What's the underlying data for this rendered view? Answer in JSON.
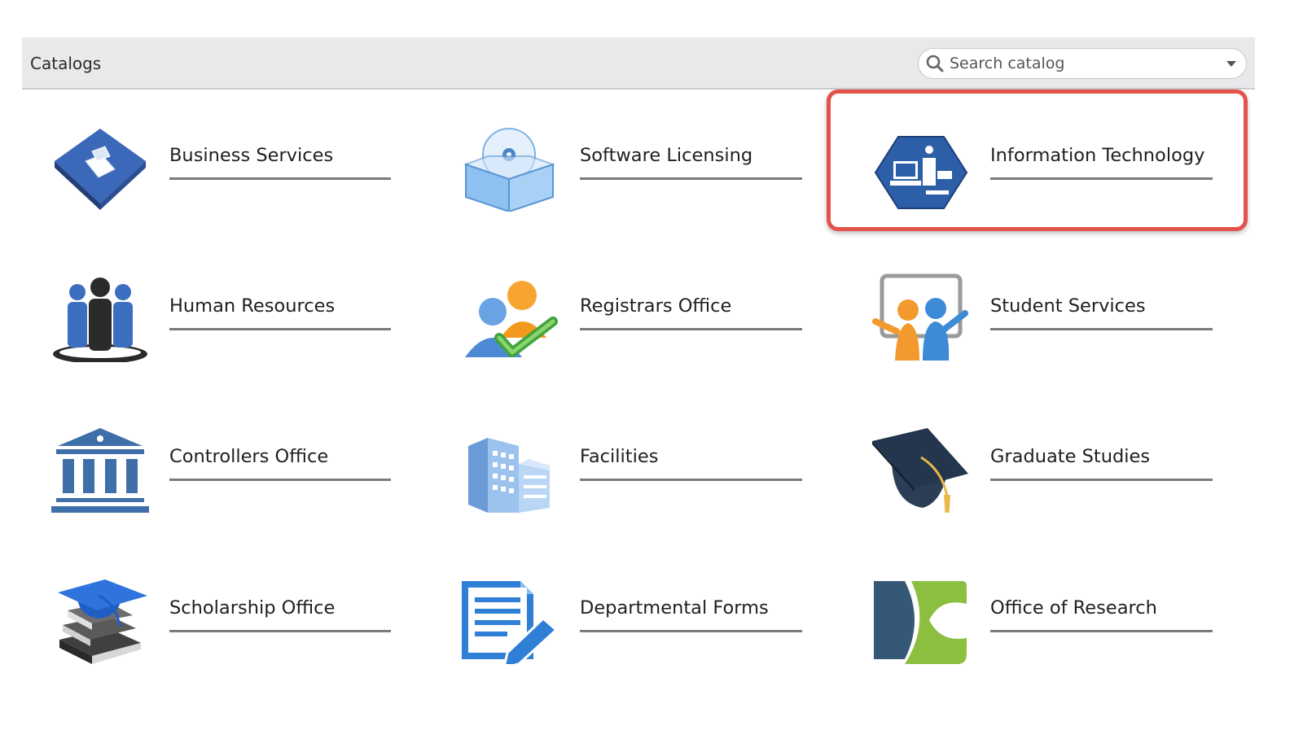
{
  "header": {
    "title": "Catalogs",
    "search_placeholder": "Search catalog"
  },
  "catalogs": [
    {
      "label": "Business Services",
      "icon": "folder-icon"
    },
    {
      "label": "Software Licensing",
      "icon": "software-box-icon"
    },
    {
      "label": "Information Technology",
      "icon": "computer-hardware-icon"
    },
    {
      "label": "Human Resources",
      "icon": "people-group-icon"
    },
    {
      "label": "Registrars Office",
      "icon": "user-check-icon"
    },
    {
      "label": "Student Services",
      "icon": "students-board-icon"
    },
    {
      "label": "Controllers Office",
      "icon": "bank-building-icon"
    },
    {
      "label": "Facilities",
      "icon": "office-building-icon"
    },
    {
      "label": "Graduate Studies",
      "icon": "graduation-cap-icon"
    },
    {
      "label": "Scholarship Office",
      "icon": "books-cap-icon"
    },
    {
      "label": "Departmental Forms",
      "icon": "form-edit-icon"
    },
    {
      "label": "Office of Research",
      "icon": "research-logo-icon"
    }
  ],
  "highlighted_catalog": "Information Technology",
  "colors": {
    "highlight": "#e2534b",
    "header_bg": "#e8e9eb",
    "underline": "#7b7b7b",
    "icon_blue": "#3d6fc0"
  }
}
